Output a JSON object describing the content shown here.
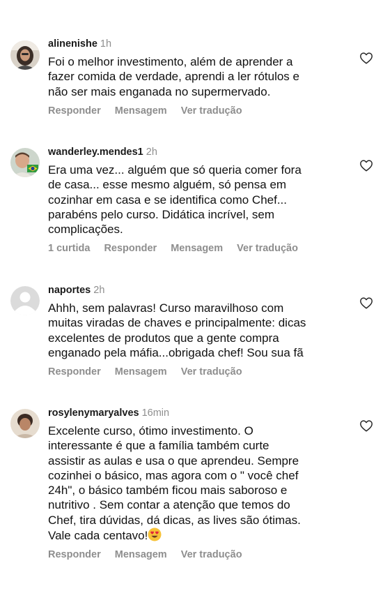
{
  "comments": [
    {
      "username": "alinenishe",
      "time": "1h",
      "text": "Foi o melhor investimento, além de aprender a\nfazer comida de verdade, aprendi a ler rótulos e\nnão ser mais enganada no supermervado.",
      "actions": {
        "reply": "Responder",
        "message": "Mensagem",
        "translate": "Ver tradução"
      }
    },
    {
      "username": "wanderley.mendes1",
      "time": "2h",
      "text": "Era uma vez... alguém que só queria comer fora\nde casa... esse mesmo alguém, só pensa em\ncozinhar em casa e se identifica como Chef...\nparabéns pelo curso. Didática incrível, sem\ncomplicações.",
      "actions": {
        "likes": "1 curtida",
        "reply": "Responder",
        "message": "Mensagem",
        "translate": "Ver tradução"
      }
    },
    {
      "username": "naportes",
      "time": "2h",
      "text": "Ahhh, sem palavras! Curso maravilhoso com\nmuitas viradas de chaves e principalmente: dicas\nexcelentes de produtos que a gente compra\nenganado pela máfia...obrigada chef! Sou sua fã",
      "actions": {
        "reply": "Responder",
        "message": "Mensagem",
        "translate": "Ver tradução"
      }
    },
    {
      "username": "rosylenymaryalves",
      "time": "16min",
      "text": "Excelente curso, ótimo investimento.  O\ninteressante é que a família também curte\nassistir as aulas e usa o que aprendeu.  Sempre\ncozinhei o básico,  mas agora com o \" você chef\n24h\", o básico também ficou mais saboroso e\nnutritivo . Sem contar  a atenção que temos do\nChef, tira dúvidas,  dá dicas, as lives são ótimas.\nVale cada centavo!",
      "emoji": "heart-eyes-emoji",
      "actions": {
        "reply": "Responder",
        "message": "Mensagem",
        "translate": "Ver tradução"
      }
    }
  ],
  "icons": {
    "like": "heart-outline-icon",
    "avatar_placeholder": "default-profile-icon"
  },
  "colors": {
    "muted": "#8e8e8e",
    "text": "#111111"
  }
}
